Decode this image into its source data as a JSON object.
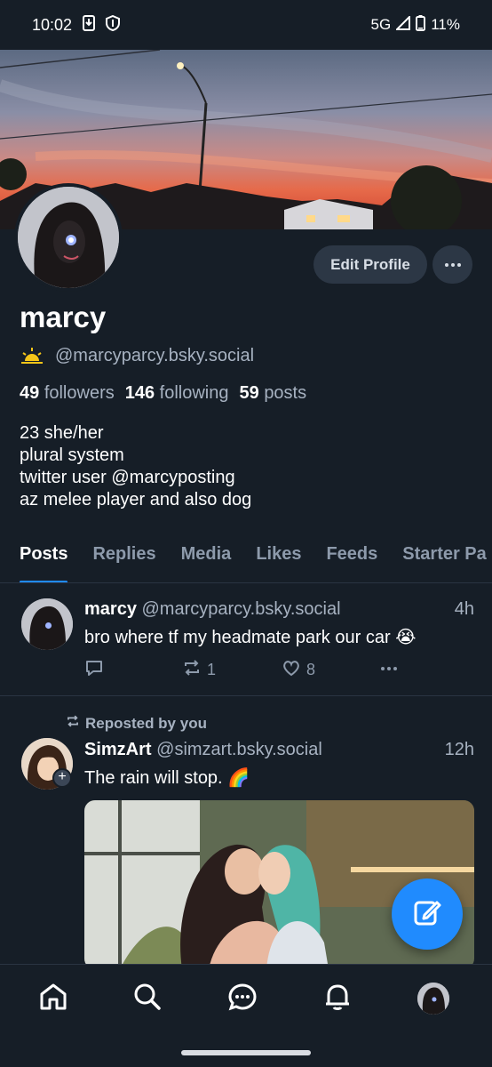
{
  "status_bar": {
    "time": "10:02",
    "network": "5G",
    "battery": "11%"
  },
  "profile": {
    "display_name": "marcy",
    "handle": "@marcyparcy.bsky.social",
    "handle_emoji": "sunset-icon",
    "followers_count": "49",
    "followers_label": "followers",
    "following_count": "146",
    "following_label": "following",
    "posts_count": "59",
    "posts_label": "posts",
    "bio_lines": [
      "23 she/her",
      "plural system",
      "twitter user @marcyposting",
      "az melee player and also dog"
    ],
    "edit_label": "Edit Profile"
  },
  "tabs": [
    "Posts",
    "Replies",
    "Media",
    "Likes",
    "Feeds",
    "Starter Pa"
  ],
  "active_tab": "Posts",
  "posts": [
    {
      "author": "marcy",
      "handle": "@marcyparcy.bsky.social",
      "time": "4h",
      "text": "bro where tf my headmate park our car 😭",
      "reposts": "1",
      "likes": "8"
    },
    {
      "repost_label": "Reposted by you",
      "author": "SimzArt",
      "handle": "@simzart.bsky.social",
      "time": "12h",
      "text": "The rain will stop. 🌈"
    }
  ],
  "colors": {
    "accent": "#208bfe",
    "background": "#161e27",
    "muted": "#a7b2c1"
  }
}
